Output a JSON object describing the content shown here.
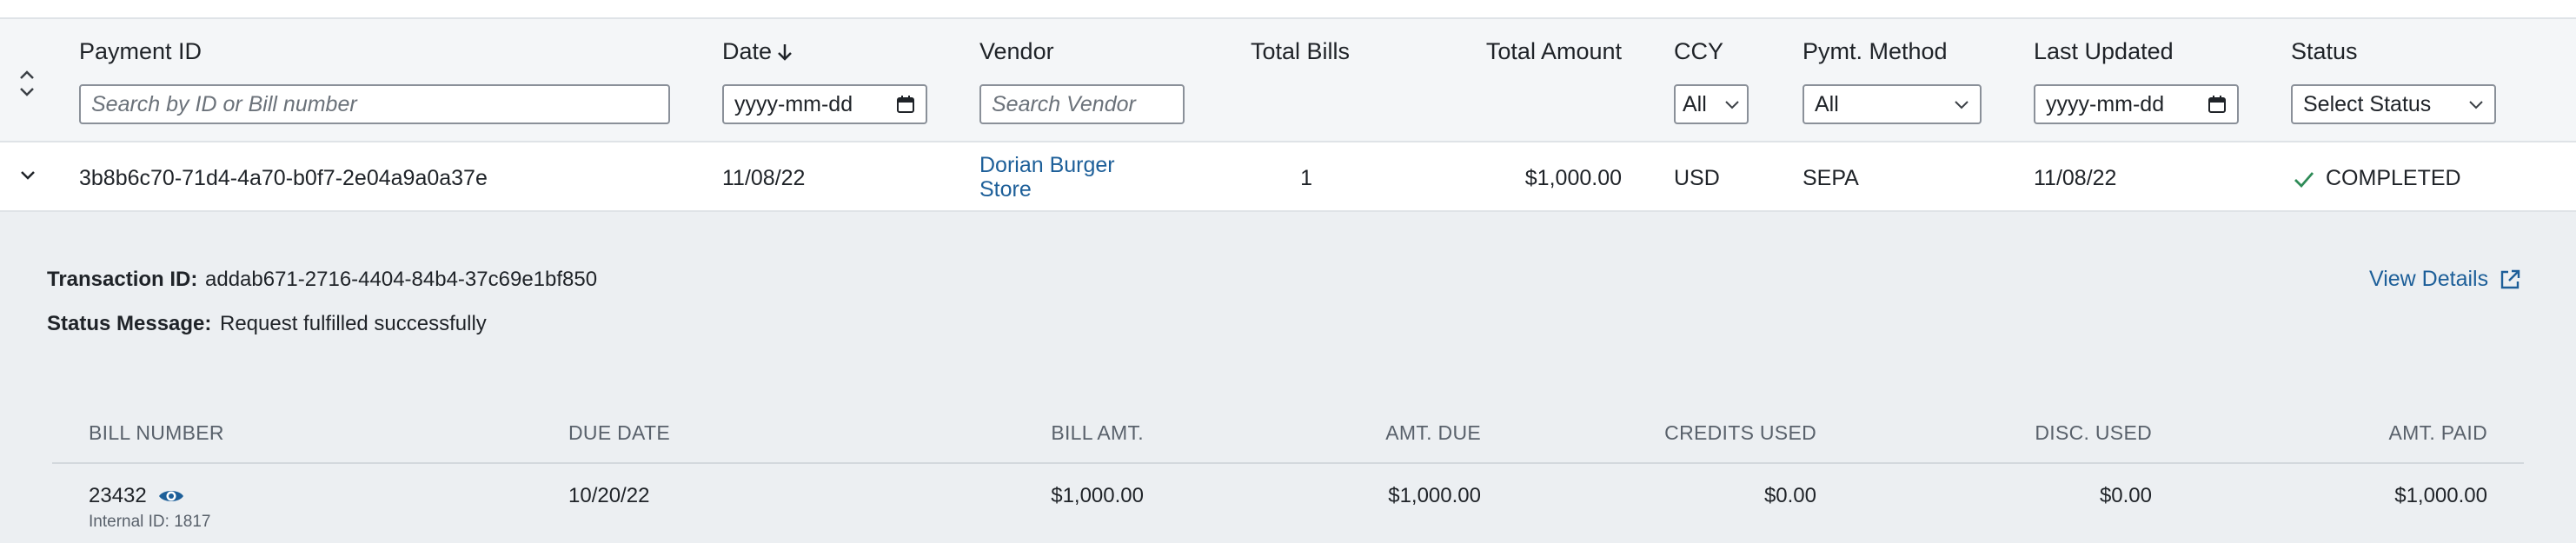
{
  "header": {
    "columns": {
      "payment_id": "Payment ID",
      "date": "Date",
      "date_sort_icon": "arrow-down",
      "vendor": "Vendor",
      "total_bills": "Total Bills",
      "total_amount": "Total Amount",
      "ccy": "CCY",
      "pymt_method": "Pymt. Method",
      "last_updated": "Last Updated",
      "status": "Status"
    },
    "filters": {
      "payment_id_placeholder": "Search by ID or Bill number",
      "date_placeholder": "yyyy-mm-dd",
      "vendor_placeholder": "Search Vendor",
      "ccy_value": "All",
      "pymt_method_value": "All",
      "last_updated_placeholder": "yyyy-mm-dd",
      "status_value": "Select Status"
    }
  },
  "row": {
    "payment_id": "3b8b6c70-71d4-4a70-b0f7-2e04a9a0a37e",
    "date": "11/08/22",
    "vendor_line1": "Dorian Burger",
    "vendor_line2": "Store",
    "total_bills": "1",
    "total_amount": "$1,000.00",
    "ccy": "USD",
    "pymt_method": "SEPA",
    "last_updated": "11/08/22",
    "status": "COMPLETED"
  },
  "details": {
    "transaction_id_label": "Transaction ID:",
    "transaction_id": "addab671-2716-4404-84b4-37c69e1bf850",
    "status_message_label": "Status Message:",
    "status_message": "Request fulfilled successfully",
    "view_details": "View Details",
    "bills": {
      "headers": {
        "bill_number": "BILL NUMBER",
        "due_date": "DUE DATE",
        "bill_amt": "BILL AMT.",
        "amt_due": "AMT. DUE",
        "credits_used": "CREDITS USED",
        "disc_used": "DISC. USED",
        "amt_paid": "AMT. PAID"
      },
      "rows": [
        {
          "bill_number": "23432",
          "internal_id": "Internal ID: 1817",
          "due_date": "10/20/22",
          "bill_amt": "$1,000.00",
          "amt_due": "$1,000.00",
          "credits_used": "$0.00",
          "disc_used": "$0.00",
          "amt_paid": "$1,000.00"
        }
      ]
    }
  },
  "colors": {
    "link": "#1d5f99",
    "success": "#2e8b57",
    "header_bg": "#f4f6f8",
    "details_bg": "#eceff2"
  }
}
